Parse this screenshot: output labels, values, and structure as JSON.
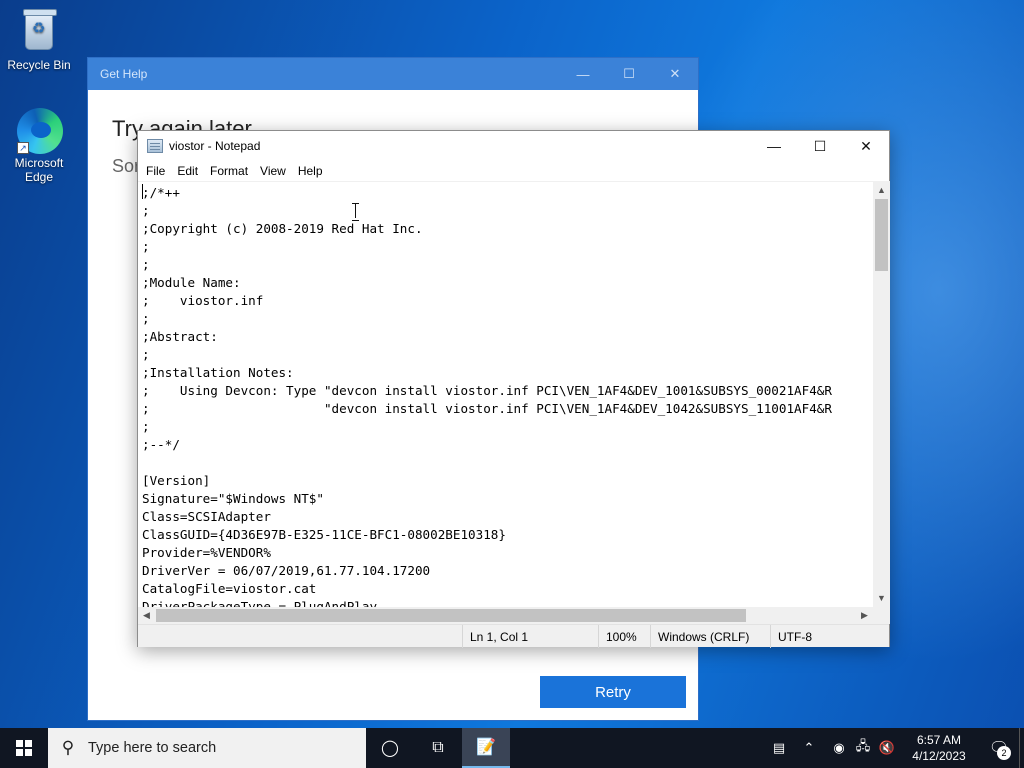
{
  "desktop": {
    "icons": [
      {
        "label": "Recycle Bin"
      },
      {
        "label": "Microsoft Edge"
      }
    ]
  },
  "gethelp": {
    "title": "Get Help",
    "heading": "Try again later",
    "subtext": "Sor",
    "retry_label": "Retry"
  },
  "notepad": {
    "title": "viostor - Notepad",
    "menu": [
      "File",
      "Edit",
      "Format",
      "View",
      "Help"
    ],
    "lines": [
      ";/*++",
      ";",
      ";Copyright (c) 2008-2019 Red Hat Inc.",
      ";",
      ";",
      ";Module Name:",
      ";    viostor.inf",
      ";",
      ";Abstract:",
      ";",
      ";Installation Notes:",
      ";    Using Devcon: Type \"devcon install viostor.inf PCI\\VEN_1AF4&DEV_1001&SUBSYS_00021AF4&R",
      ";                       \"devcon install viostor.inf PCI\\VEN_1AF4&DEV_1042&SUBSYS_11001AF4&R",
      ";",
      ";--*/",
      "",
      "[Version]",
      "Signature=\"$Windows NT$\"",
      "Class=SCSIAdapter",
      "ClassGUID={4D36E97B-E325-11CE-BFC1-08002BE10318}",
      "Provider=%VENDOR%",
      "DriverVer = 06/07/2019,61.77.104.17200",
      "CatalogFile=viostor.cat",
      "DriverPackageType = PlugAndPlay"
    ],
    "status": {
      "position": "Ln 1, Col 1",
      "zoom": "100%",
      "line_ending": "Windows (CRLF)",
      "encoding": "UTF-8"
    }
  },
  "taskbar": {
    "search_placeholder": "Type here to search",
    "clock_time": "6:57 AM",
    "clock_date": "4/12/2023",
    "notification_count": "2"
  }
}
